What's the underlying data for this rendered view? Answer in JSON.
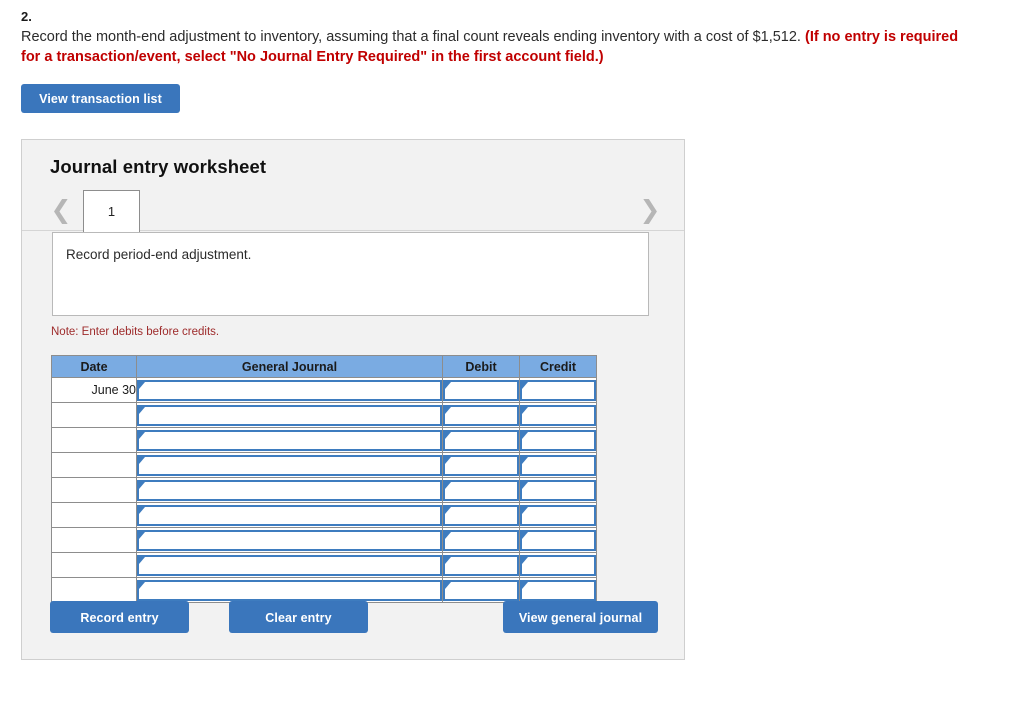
{
  "question": {
    "number": "2.",
    "text_plain": "Record the month-end adjustment to inventory, assuming that a final count reveals ending inventory with a cost of $1,512. ",
    "text_hint": "(If no entry is required for a transaction/event, select \"No Journal Entry Required\" in the first account field.)"
  },
  "toolbar": {
    "view_transaction_list": "View transaction list"
  },
  "worksheet": {
    "title": "Journal entry worksheet",
    "prev_icon": "chevron-left-icon",
    "next_icon": "chevron-right-icon",
    "tabs": [
      {
        "label": "1",
        "active": true
      }
    ],
    "description": "Record period-end adjustment.",
    "note": "Note: Enter debits before credits."
  },
  "table": {
    "headers": [
      "Date",
      "General Journal",
      "Debit",
      "Credit"
    ],
    "rows": [
      {
        "date": "June 30",
        "journal": "",
        "debit": "",
        "credit": ""
      },
      {
        "date": "",
        "journal": "",
        "debit": "",
        "credit": ""
      },
      {
        "date": "",
        "journal": "",
        "debit": "",
        "credit": ""
      },
      {
        "date": "",
        "journal": "",
        "debit": "",
        "credit": ""
      },
      {
        "date": "",
        "journal": "",
        "debit": "",
        "credit": ""
      },
      {
        "date": "",
        "journal": "",
        "debit": "",
        "credit": ""
      },
      {
        "date": "",
        "journal": "",
        "debit": "",
        "credit": ""
      },
      {
        "date": "",
        "journal": "",
        "debit": "",
        "credit": ""
      },
      {
        "date": "",
        "journal": "",
        "debit": "",
        "credit": ""
      }
    ]
  },
  "actions": {
    "record_entry": "Record entry",
    "clear_entry": "Clear entry",
    "view_general_journal": "View general journal"
  },
  "colors": {
    "button_blue": "#3a76bc",
    "header_blue": "#7aabe2",
    "input_border_blue": "#3e7cbf",
    "hint_red": "#c00000",
    "note_red": "#9e2b2b",
    "card_bg": "#f2f2f2"
  }
}
